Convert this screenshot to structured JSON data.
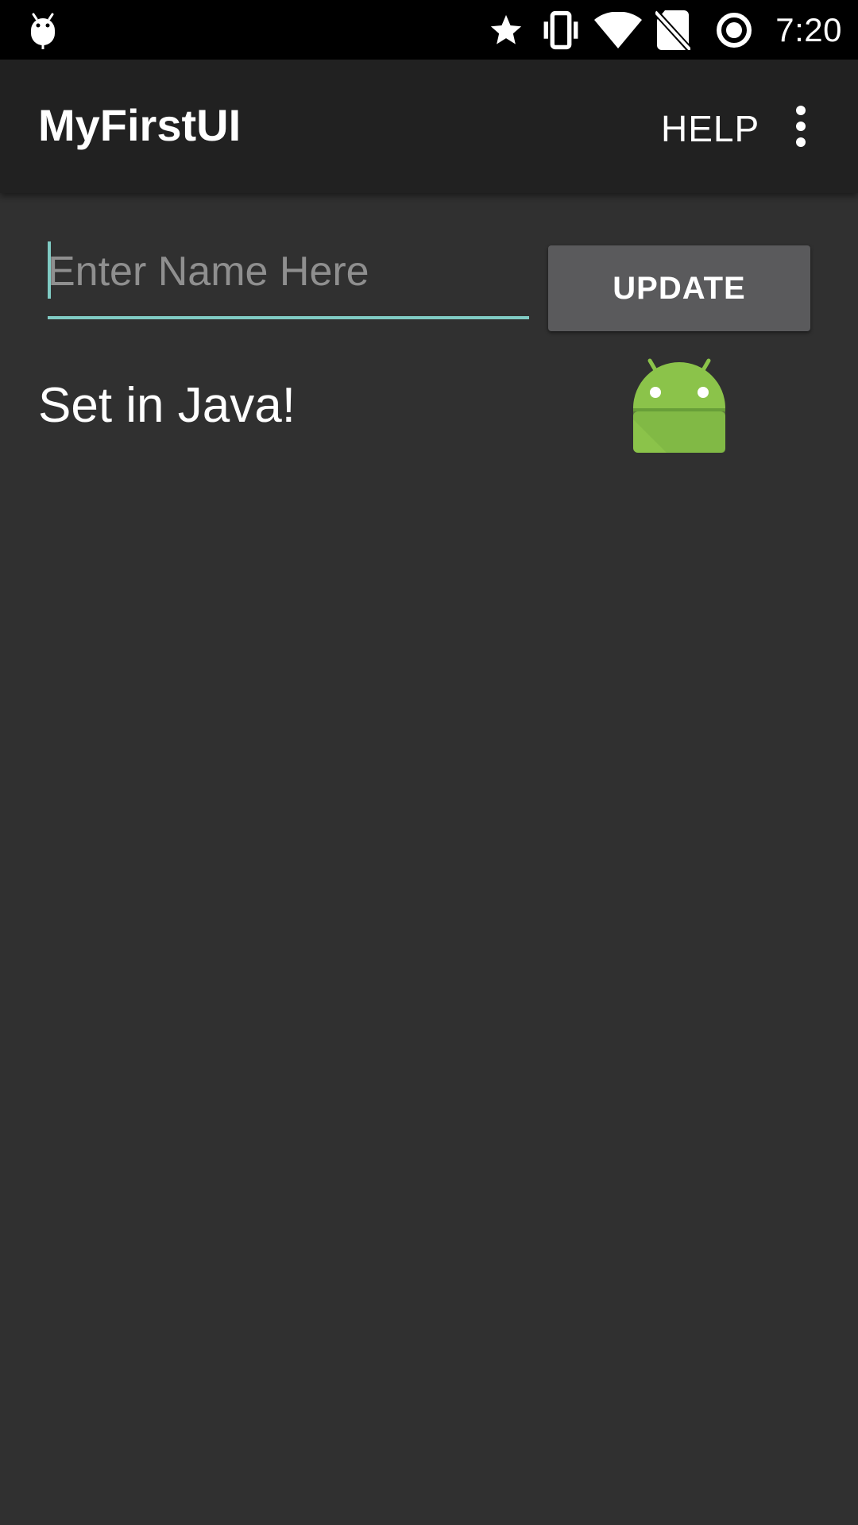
{
  "status_bar": {
    "left_icon": "android-debug-icon",
    "icons": [
      "star-icon",
      "vibrate-icon",
      "wifi-icon",
      "no-sim-icon",
      "battery-saver-icon"
    ],
    "time": "7:20"
  },
  "app_bar": {
    "title": "MyFirstUI",
    "help_label": "HELP",
    "overflow_icon": "more-vert-icon"
  },
  "main": {
    "name_input": {
      "value": "",
      "placeholder": "Enter Name Here"
    },
    "update_label": "UPDATE",
    "java_label": "Set in Java!",
    "image_icon": "android-robot-icon"
  },
  "colors": {
    "background": "#303030",
    "app_bar": "#212121",
    "status_bar": "#000000",
    "accent": "#80cbc4",
    "button": "#5a5a5c",
    "android_green": "#8bc34a"
  }
}
